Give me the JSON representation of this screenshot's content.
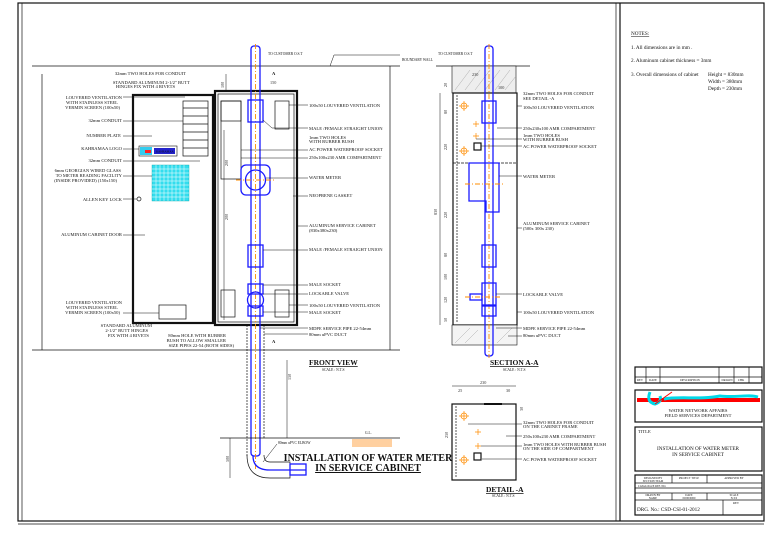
{
  "drawing": {
    "title_line1": "INSTALLATION OF WATER METER",
    "title_line2": "IN SERVICE CABINET",
    "colors": {
      "pipe": "#1a1aff",
      "centerline": "#ff8c00",
      "glass": "#33ddee",
      "logo_red": "#ff0000"
    }
  },
  "front_view": {
    "title": "FRONT VIEW",
    "scale": "SCALE : N.T.S",
    "to_customer": "TO CUSTOMER O.S.T",
    "boundary_wall": "BOUNDARY WALL",
    "section_marker": "A",
    "left_labels": [
      "32mm TWO HOLES FOR CONDUIT",
      "STANDARD ALUMINUM 2-1/2\" BUTT",
      "HINGES FIX WITH 4 RIVETS",
      "LOUVERED VENTILATION",
      "WITH STAINLESS STEEL",
      "VERMIN SCREEN (100x50)",
      "32mm CONDUIT",
      "NUMBER PLATE",
      "KAHRAMAA LOGO",
      "32mm CONDUIT",
      "6mm GEORGIAN WIRED GLASS",
      "TO METER READING FACILITY",
      "(INSIDE PROVIDED) (150x150)",
      "ALLEN KEY LOCK",
      "ALUMINUM CABINET DOOR",
      "LOUVERED VENTILATION",
      "WITH STAINLESS STEEL",
      "VERMIN SCREEN (100x50)",
      "STANDARD ALUMINUM",
      "2-1/2\" BUTT HINGES",
      "FIX WITH 4 RIVETS",
      "80mm HOLE WITH RUBBER",
      "BUSH TO ALLOW SMALLER",
      "SIZE PIPES 22-54 (BOTH SIDES)"
    ],
    "right_labels": [
      "100x50 LOUVERED VENTILATION",
      "MALE /FEMALE STRAIGHT UNION",
      "1mm TWO HOLES",
      "WITH RUBBER BUSH",
      "AC POWER WATERPROOF SOCKET",
      "250x100x230 AMR COMPARTMENT",
      "WATER METER",
      "NEOPRENE GASKET",
      "ALUMINUM SERVICE CABINET",
      "(830x380x230)",
      "MALE /FEMALE STRAIGHT UNION",
      "MALE SOCKET",
      "LOCKABLE  VALVE",
      "100x50 LOUVERED VENTILATION",
      "MALE SOCKET",
      "MDPE SERVICE PIPE 22-54mm",
      "80mm uPVC DUCT"
    ],
    "elbow_label": "80mm uPVC ELBOW",
    "ground_label": "G.L.",
    "logo_text": "KAHRAMAA",
    "dims": [
      "150",
      "100",
      "200",
      "200",
      "150",
      "500"
    ]
  },
  "section_aa": {
    "title": "SECTION A-A",
    "scale": "SCALE : N.T.S",
    "to_customer": "TO CUSTOMER O.S.T",
    "labels": [
      "32mm TWO HOLES FOR CONDUIT",
      "SEE DETAIL -A",
      "100x50 LOUVERED VENTILATION",
      "250x230x100 AMR COMPARTMENT",
      "1mm TWO HOLES",
      "WITH RUBBER BUSH",
      "AC POWER WATERPROOF SOCKET",
      "WATER METER",
      "ALUMINUM SERVICE CABINET",
      "(500x 300x 230)",
      "LOCKABLE  VALVE",
      "100x50 LOUVERED VENTILATION",
      "MDPE SERVICE PIPE 22-54mm",
      "80mm uPVC DUCT"
    ],
    "dims": [
      "230",
      "100",
      "20",
      "80",
      "220",
      "830",
      "220",
      "80",
      "100",
      "120",
      "50"
    ]
  },
  "detail_a": {
    "title": "DETAIL -A",
    "scale": "SCALE : N.T.S",
    "labels": [
      "32mm TWO HOLES FOR CONDUIT",
      "ON THE CABINET FRAME",
      "250x100x230 AMR COMPARTMENT",
      "1mm TWO HOLES WITH RUBBER BUSH",
      "ON THE SIDE OF COMPARTMENT",
      "AC POWER WATERPROOF SOCKET"
    ],
    "dims": [
      "230",
      "25",
      "30",
      "250",
      "30"
    ]
  },
  "notes": {
    "heading": "NOTES:",
    "items": [
      "1.   All dimensions are in mm .",
      "2.   Aluminum cabinet thickness =  3mm",
      "3.   Overall dimensions of cabinet"
    ],
    "overall": [
      "Height = 830mm",
      "Width = 380mm",
      "Depth = 230mm"
    ]
  },
  "title_block": {
    "rev_headers": [
      "REV",
      "DATE",
      "DESCRIPTION",
      "DRAWN",
      "CHK"
    ],
    "department_line1": "WATER NETWORK AFFAIRS",
    "department_line2": "FIELD SERVICES DEPARTMENT",
    "title_label": "TITLE",
    "title_line1": "INSTALLATION OF WATER METER",
    "title_line2": "IN SERVICE CABINET",
    "cells": [
      "DESIGNED BY",
      "SECTION TEAM",
      "PROJECT TITLE",
      "APPROVED BY",
      "CATALOGUE REF. NO.",
      "DRAWN BY",
      "NAME",
      "DATE",
      "00/00/0000",
      "SCALE",
      "N.T.S"
    ],
    "drg_no": "DRG. No.: CSD-CSI-01-2012",
    "rev_label": "REV"
  }
}
